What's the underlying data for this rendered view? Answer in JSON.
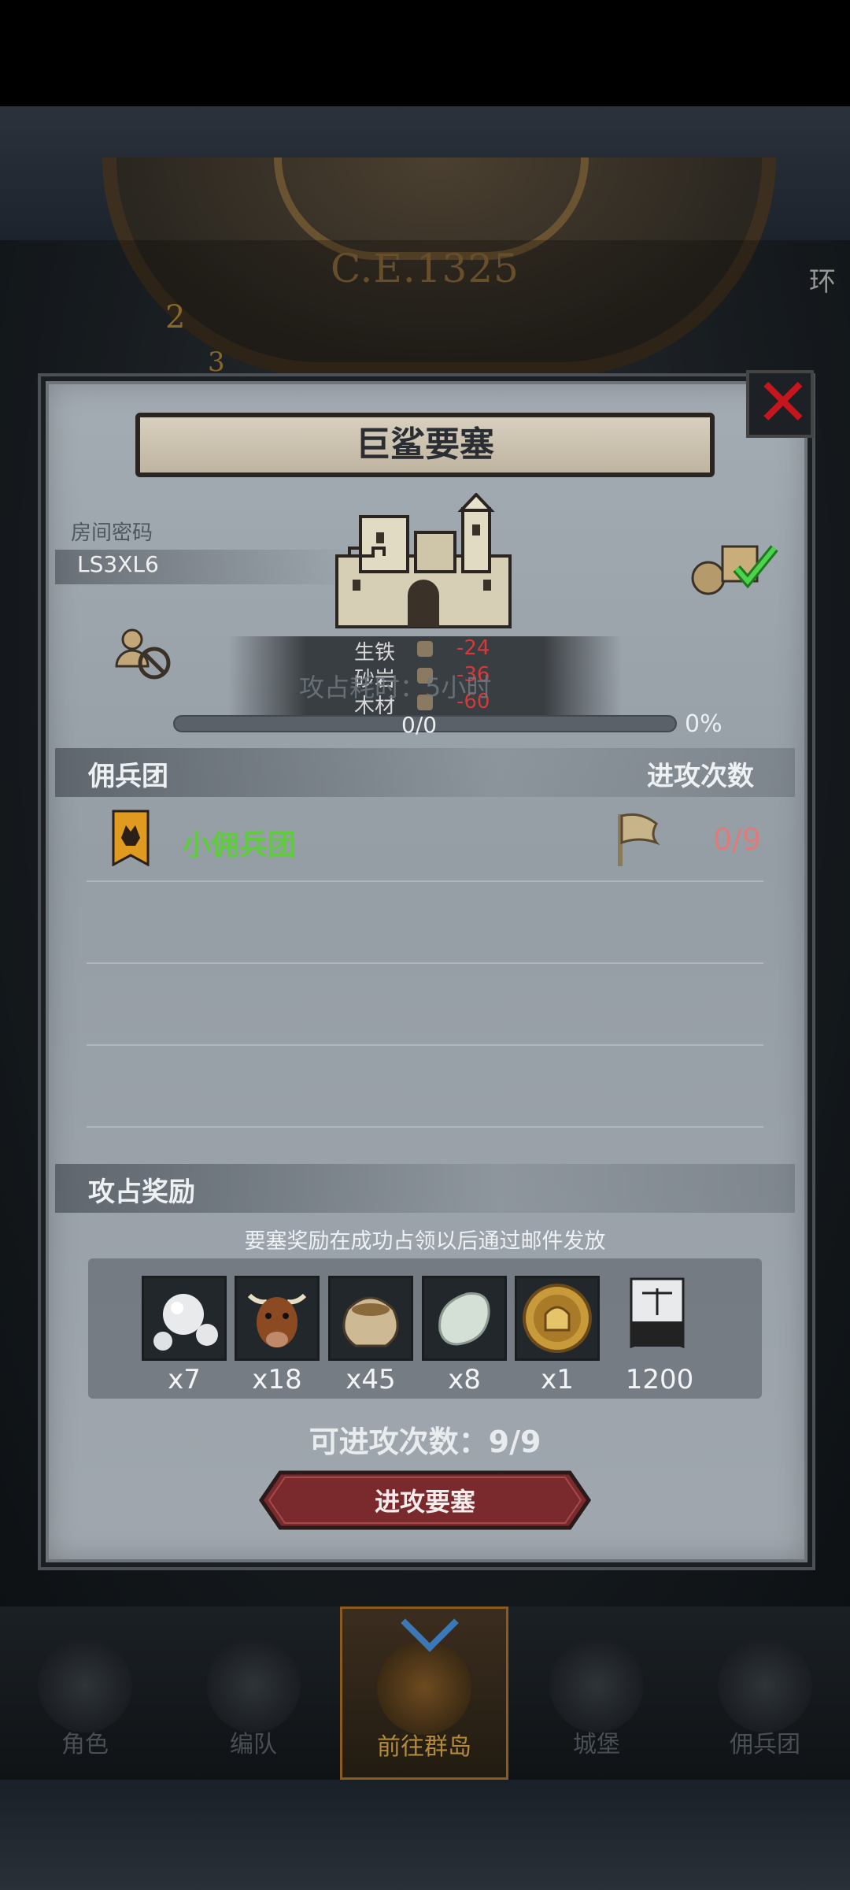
{
  "header": {
    "era": "C.E.1325"
  },
  "dialog": {
    "title": "巨鲨要塞",
    "room_label": "房间密码",
    "room_code": "LS3XL6",
    "resources": [
      {
        "name": "生铁",
        "value": "-24"
      },
      {
        "name": "砂岩",
        "value": "-36"
      },
      {
        "name": "木材",
        "value": "-60"
      }
    ],
    "attack_time": "攻占耗时：5小时",
    "progress": {
      "text": "0/0",
      "percent": "0%",
      "fill": 0
    },
    "mercenary_section": {
      "title": "佣兵团",
      "attack_count_label": "进攻次数",
      "rows": [
        {
          "name": "小佣兵团",
          "count": "0/9"
        }
      ]
    },
    "reward_section": {
      "title": "攻占奖励",
      "note": "要塞奖励在成功占领以后通过邮件发放",
      "items": [
        {
          "icon": "pearl-icon",
          "qty": "x7"
        },
        {
          "icon": "cattle-icon",
          "qty": "x18"
        },
        {
          "icon": "grain-sack-icon",
          "qty": "x45"
        },
        {
          "icon": "jade-stone-icon",
          "qty": "x8"
        },
        {
          "icon": "knight-coin-icon",
          "qty": "x1"
        },
        {
          "icon": "justice-banner-icon",
          "qty": "1200"
        }
      ]
    },
    "remaining_attacks": {
      "label": "可进攻次数：",
      "value": "9/9"
    },
    "attack_button": "进攻要塞"
  },
  "bottom_nav": {
    "items": [
      {
        "label": "角色",
        "active": false
      },
      {
        "label": "编队",
        "active": false
      },
      {
        "label": "前往群岛",
        "active": true
      },
      {
        "label": "城堡",
        "active": false
      },
      {
        "label": "佣兵团",
        "active": false
      }
    ]
  },
  "colors": {
    "accent_green": "#5fcc3d",
    "accent_red": "#c4161c",
    "count_red": "#e07b7b",
    "button_red": "#7a2a2c"
  }
}
